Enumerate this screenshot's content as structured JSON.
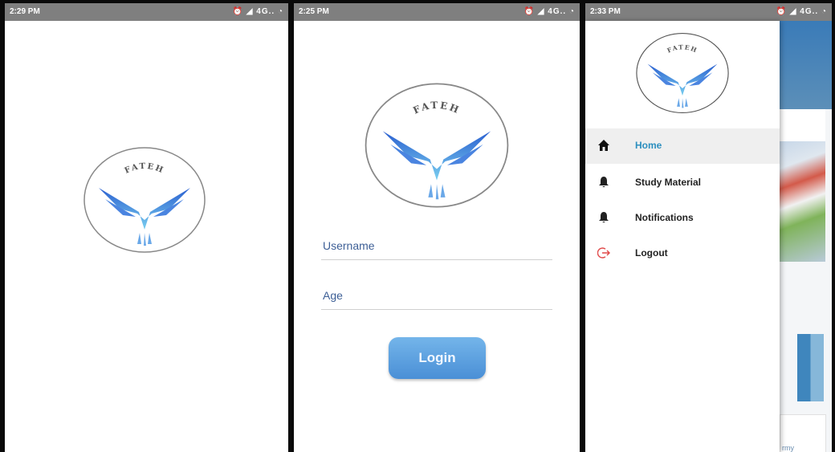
{
  "screens": [
    {
      "status": {
        "time": "2:29 PM",
        "icons": "⏰ ◢ 4G.. ◔"
      }
    },
    {
      "status": {
        "time": "2:25 PM",
        "icons": "⏰ ◢ 4G.. ◔"
      },
      "username_label": "Username",
      "age_label": "Age",
      "login_label": "Login"
    },
    {
      "status": {
        "time": "2:33 PM",
        "icons": "⏰ ◢ 4G.. ◔"
      },
      "menu": [
        {
          "label": "Home",
          "icon": "home-icon",
          "active": true
        },
        {
          "label": "Study Material",
          "icon": "bell-icon",
          "active": false
        },
        {
          "label": "Notifications",
          "icon": "bell-icon",
          "active": false
        },
        {
          "label": "Logout",
          "icon": "logout-icon",
          "active": false
        }
      ],
      "background_tile_text": "rmy"
    }
  ],
  "logo": {
    "text": "FATEH"
  },
  "colors": {
    "accent": "#2c8fbf",
    "field_label": "#3d5f96",
    "button": "#5a9fe0",
    "logout": "#e04848"
  }
}
